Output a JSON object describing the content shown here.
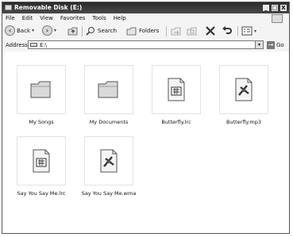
{
  "window": {
    "title": "Removable Disk (E:)",
    "controls": {
      "minimize": "_",
      "maximize": "□",
      "close": "X"
    }
  },
  "menu": [
    "File",
    "Edit",
    "View",
    "Favorites",
    "Tools",
    "Help"
  ],
  "toolbar": {
    "back_label": "Back",
    "search_label": "Search",
    "folders_label": "Folders"
  },
  "address": {
    "label": "Address",
    "value": "E:\\",
    "go_label": "Go"
  },
  "files": [
    {
      "name": "My Songs",
      "type": "folder"
    },
    {
      "name": "My Documents",
      "type": "folder"
    },
    {
      "name": "Butterfly.lrc",
      "type": "lrc"
    },
    {
      "name": "Butterfly.mp3",
      "type": "media"
    },
    {
      "name": "Say You Say Me.lrc",
      "type": "lrc"
    },
    {
      "name": "Say You Say Me.wma",
      "type": "media"
    }
  ]
}
